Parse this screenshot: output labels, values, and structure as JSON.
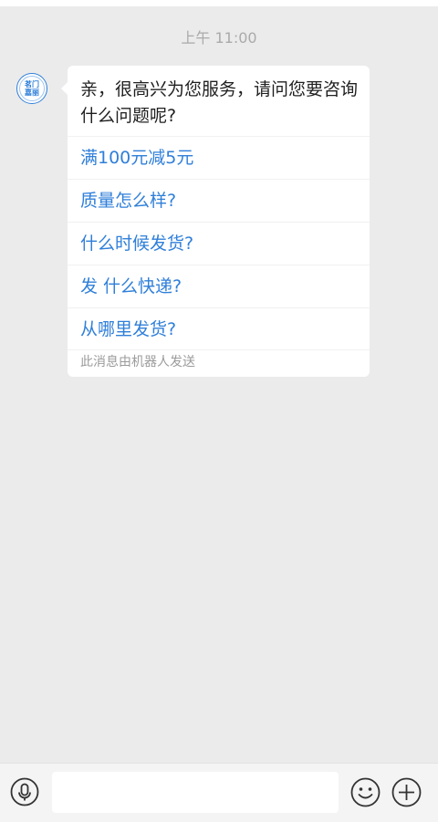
{
  "status_time": "上午 11:00",
  "chat": {
    "agent_avatar": {
      "line1": "茗门",
      "line2": "嘉丽"
    },
    "message": {
      "greeting": "亲，很高兴为您服务，请问您要咨询什么问题呢?",
      "options": [
        {
          "label": "满100元减5元"
        },
        {
          "label": "质量怎么样?"
        },
        {
          "label": "什么时候发货?"
        },
        {
          "label": "发 什么快递?"
        },
        {
          "label": "从哪里发货?"
        }
      ],
      "footnote": "此消息由机器人发送"
    }
  },
  "input_bar": {
    "voice_icon": "microphone-icon",
    "input_value": "",
    "emoji_icon": "smiley-icon",
    "more_icon": "plus-circle-icon"
  },
  "colors": {
    "background": "#ebebeb",
    "bubble": "#ffffff",
    "link": "#2f7fd9",
    "timestamp": "#aaaaaa",
    "footnote": "#9b9b9b"
  }
}
